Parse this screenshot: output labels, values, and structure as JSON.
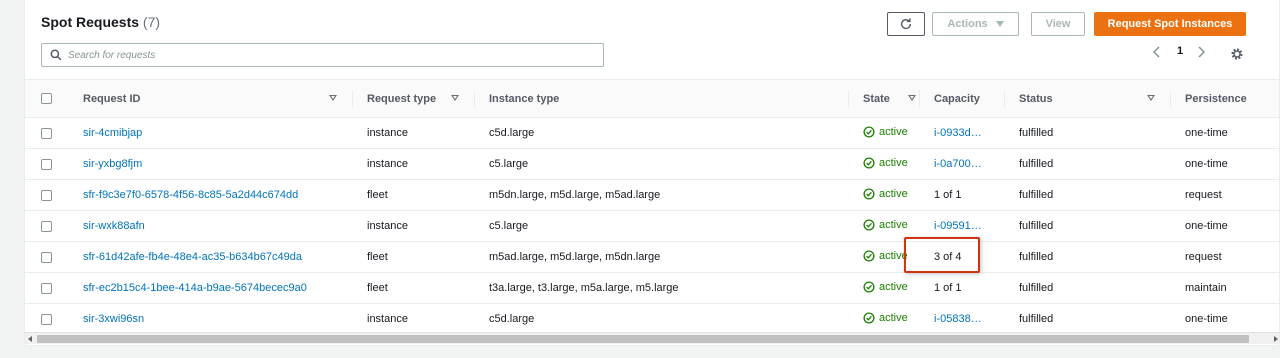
{
  "header": {
    "title": "Spot Requests",
    "count": "(7)",
    "actions_label": "Actions",
    "view_label": "View",
    "primary_label": "Request Spot Instances"
  },
  "search": {
    "placeholder": "Search for requests"
  },
  "pagination": {
    "current_page": "1"
  },
  "columns": [
    "Request ID",
    "Request type",
    "Instance type",
    "State",
    "Capacity",
    "Status",
    "Persistence"
  ],
  "rows": [
    {
      "id": "sir-4cmibjap",
      "type": "instance",
      "instance_type": "c5d.large",
      "state": "active",
      "capacity": "i-0933d…",
      "capacity_link": true,
      "status": "fulfilled",
      "persistence": "one-time"
    },
    {
      "id": "sir-yxbg8fjm",
      "type": "instance",
      "instance_type": "c5.large",
      "state": "active",
      "capacity": "i-0a700…",
      "capacity_link": true,
      "status": "fulfilled",
      "persistence": "one-time"
    },
    {
      "id": "sfr-f9c3e7f0-6578-4f56-8c85-5a2d44c674dd",
      "type": "fleet",
      "instance_type": "m5dn.large, m5d.large, m5ad.large",
      "state": "active",
      "capacity": "1 of 1",
      "capacity_link": false,
      "status": "fulfilled",
      "persistence": "request"
    },
    {
      "id": "sir-wxk88afn",
      "type": "instance",
      "instance_type": "c5.large",
      "state": "active",
      "capacity": "i-09591…",
      "capacity_link": true,
      "status": "fulfilled",
      "persistence": "one-time"
    },
    {
      "id": "sfr-61d42afe-fb4e-48e4-ac35-b634b67c49da",
      "type": "fleet",
      "instance_type": "m5ad.large, m5d.large, m5dn.large",
      "state": "active",
      "capacity": "3 of 4",
      "capacity_link": false,
      "status": "fulfilled",
      "persistence": "request"
    },
    {
      "id": "sfr-ec2b15c4-1bee-414a-b9ae-5674becec9a0",
      "type": "fleet",
      "instance_type": "t3a.large, t3.large, m5a.large, m5.large",
      "state": "active",
      "capacity": "1 of 1",
      "capacity_link": false,
      "status": "fulfilled",
      "persistence": "maintain"
    },
    {
      "id": "sir-3xwi96sn",
      "type": "instance",
      "instance_type": "c5d.large",
      "state": "active",
      "capacity": "i-05838…",
      "capacity_link": true,
      "status": "fulfilled",
      "persistence": "one-time"
    }
  ],
  "colors": {
    "link": "#0073bb",
    "active": "#1d8102",
    "primary": "#ec7211",
    "highlight": "#d13212"
  },
  "icons": [
    "refresh-icon",
    "caret-down-icon",
    "search-icon",
    "chevron-left-icon",
    "chevron-right-icon",
    "gear-icon",
    "check-circle-icon",
    "sort-icon"
  ]
}
